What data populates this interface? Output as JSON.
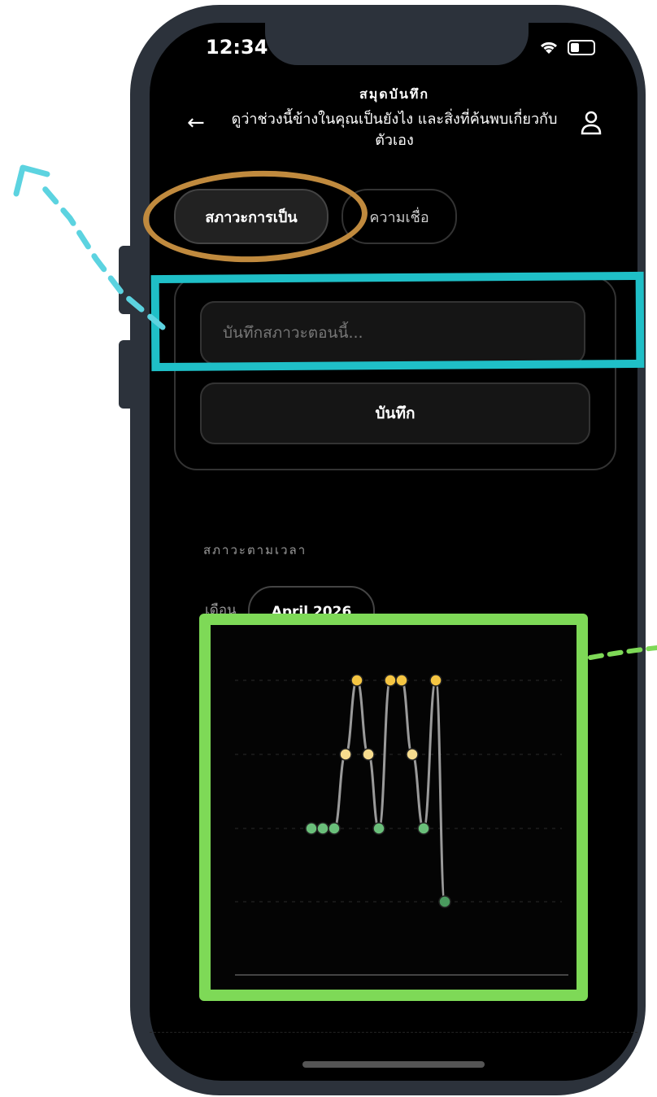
{
  "status_bar": {
    "time": "12:34"
  },
  "header": {
    "title": "สมุดบันทึก",
    "subtitle": "ดูว่าช่วงนี้ข้างในคุณเป็นยังไง และสิ่งที่ค้นพบเกี่ยวกับตัวเอง"
  },
  "tabs": [
    {
      "label": "สภาวะการเป็น",
      "active": true
    },
    {
      "label": "ความเชื่อ",
      "active": false
    }
  ],
  "entry": {
    "placeholder": "บันทึกสภาวะตอนนี้...",
    "save_label": "บันทึก"
  },
  "timeline": {
    "section_label": "สภาวะตามเวลา",
    "month_label": "เดือน",
    "month_value": "April 2026"
  },
  "colors": {
    "annotation_orange": "#c08a3e",
    "annotation_teal": "#1fbfc7",
    "annotation_green": "#7ed957",
    "point_high": "#f5c542",
    "point_mid": "#f7dc8e",
    "point_low": "#6abf7a"
  },
  "chart_data": {
    "type": "line",
    "levels": 4,
    "x": [
      1,
      2,
      3,
      4,
      5,
      6,
      7,
      8,
      9,
      10,
      11,
      12,
      13
    ],
    "values": [
      2,
      2,
      2,
      3,
      4,
      3,
      2,
      4,
      4,
      3,
      2,
      4,
      1
    ],
    "grid": true
  }
}
